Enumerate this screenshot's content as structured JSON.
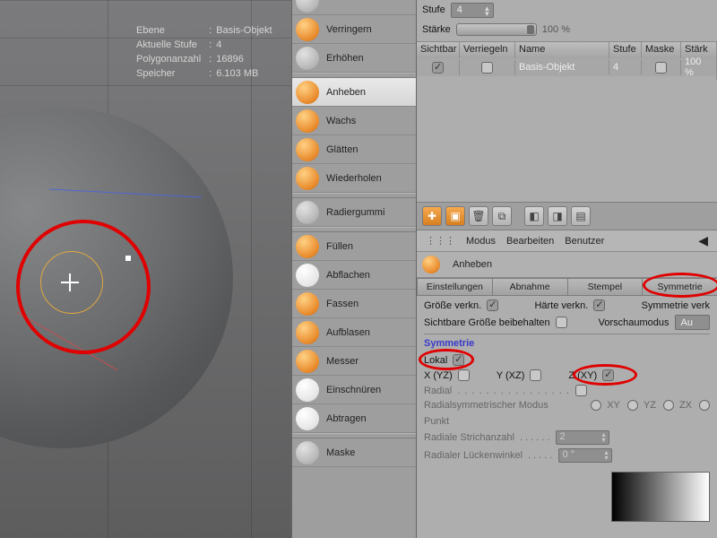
{
  "hud": {
    "rows": [
      {
        "k": "Ebene",
        "v": "Basis-Objekt"
      },
      {
        "k": "Aktuelle Stufe",
        "v": "4"
      },
      {
        "k": "Polygonanzahl",
        "v": "16896"
      },
      {
        "k": "Speicher",
        "v": "6.103 MB"
      }
    ]
  },
  "tools": [
    {
      "label": "",
      "cls": "ico-gray"
    },
    {
      "label": "Verringern",
      "cls": "ico-sphere"
    },
    {
      "label": "Erhöhen",
      "cls": "ico-gray"
    },
    {
      "sep": true
    },
    {
      "label": "Anheben",
      "cls": "ico-sphere",
      "active": true
    },
    {
      "label": "Wachs",
      "cls": "ico-sphere"
    },
    {
      "label": "Glätten",
      "cls": "ico-sphere"
    },
    {
      "label": "Wiederholen",
      "cls": "ico-sphere"
    },
    {
      "sep": true
    },
    {
      "label": "Radiergummi",
      "cls": "ico-gray"
    },
    {
      "sep": true
    },
    {
      "label": "Füllen",
      "cls": "ico-sphere"
    },
    {
      "label": "Abflachen",
      "cls": "ico-white"
    },
    {
      "label": "Fassen",
      "cls": "ico-sphere"
    },
    {
      "label": "Aufblasen",
      "cls": "ico-sphere"
    },
    {
      "label": "Messer",
      "cls": "ico-sphere"
    },
    {
      "label": "Einschnüren",
      "cls": "ico-white"
    },
    {
      "label": "Abtragen",
      "cls": "ico-white"
    },
    {
      "sep": true
    },
    {
      "label": "Maske",
      "cls": "ico-gray"
    }
  ],
  "stufe": {
    "label": "Stufe",
    "value": "4"
  },
  "staerke": {
    "label": "Stärke",
    "value": "100 %"
  },
  "layers": {
    "head": {
      "sichtbar": "Sichtbar",
      "lock": "Verriegeln",
      "name": "Name",
      "stufe": "Stufe",
      "maske": "Maske",
      "stark": "Stärk"
    },
    "row": {
      "name": "Basis-Objekt",
      "stufe": "4",
      "stark": "100 %"
    }
  },
  "menus": {
    "modus": "Modus",
    "bearbeiten": "Bearbeiten",
    "benutzer": "Benutzer"
  },
  "brush_header": "Anheben",
  "tabs": {
    "einst": "Einstellungen",
    "abnahme": "Abnahme",
    "stempel": "Stempel",
    "sym": "Symmetrie"
  },
  "row1": {
    "groesse": "Größe verkn.",
    "haerte": "Härte verkn.",
    "symverk": "Symmetrie verk"
  },
  "row2": {
    "sicht": "Sichtbare Größe beibehalten",
    "vorschau": "Vorschaumodus",
    "vorschau_val": "Au"
  },
  "sym": {
    "hdr": "Symmetrie",
    "lokal": "Lokal",
    "x": "X (YZ)",
    "y": "Y (XZ)",
    "z": "Z (XY)",
    "radial": "Radial",
    "dots": " . . . . . . . . . . . . . . . .",
    "rmode": "Radialsymmetrischer Modus",
    "rmode_opts": {
      "xy": "XY",
      "yz": "YZ",
      "zx": "ZX",
      "punkt": "Punkt"
    },
    "stitch": "Radiale Strichanzahl",
    "stitch_dots": " . . . . . .",
    "stitch_val": "2",
    "gap": "Radialer Lückenwinkel",
    "gap_dots": " . . . . .",
    "gap_val": "0 °"
  }
}
